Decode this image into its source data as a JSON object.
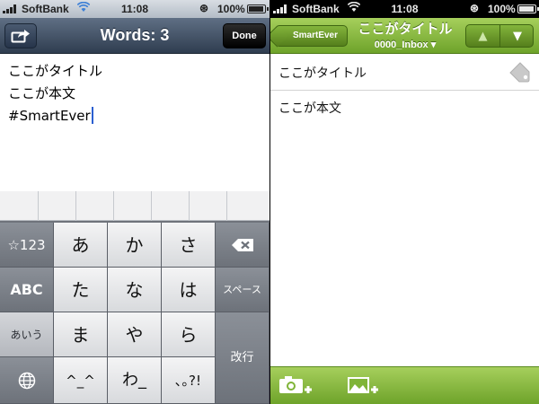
{
  "status_left": {
    "carrier": "SoftBank",
    "time": "11:08",
    "battery": "100%",
    "battery_level": 1.0
  },
  "status_right": {
    "carrier": "SoftBank",
    "time": "11:08",
    "battery": "100%",
    "battery_level": 1.0
  },
  "editor": {
    "title": "Words: 3",
    "done_label": "Done",
    "lines": [
      "ここがタイトル",
      "ここが本文",
      "#SmartEver"
    ]
  },
  "keyboard": {
    "rows": [
      [
        "☆123",
        "あ",
        "か",
        "さ",
        "⌫"
      ],
      [
        "ABC",
        "た",
        "な",
        "は",
        "スペース"
      ],
      [
        "あいう",
        "ま",
        "や",
        "ら",
        "改行"
      ],
      [
        "🌐",
        "^_^",
        "わ_",
        "､｡?!",
        ""
      ]
    ]
  },
  "viewer": {
    "back_label": "SmartEver",
    "title": "ここがタイトル",
    "notebook": "0000_Inbox ▾",
    "up_arrow": "▲",
    "down_arrow": "▼",
    "note_title": "ここがタイトル",
    "note_body": "ここが本文"
  },
  "colors": {
    "green_bar": "#8cbf44",
    "ios_bar": "#3e4d62",
    "caret": "#2b5fd0"
  },
  "icons": {
    "share": "share-icon",
    "tag": "tag-icon",
    "camera_add": "camera-add-icon",
    "image_add": "image-add-icon",
    "globe": "globe-icon",
    "backspace": "backspace-icon"
  }
}
